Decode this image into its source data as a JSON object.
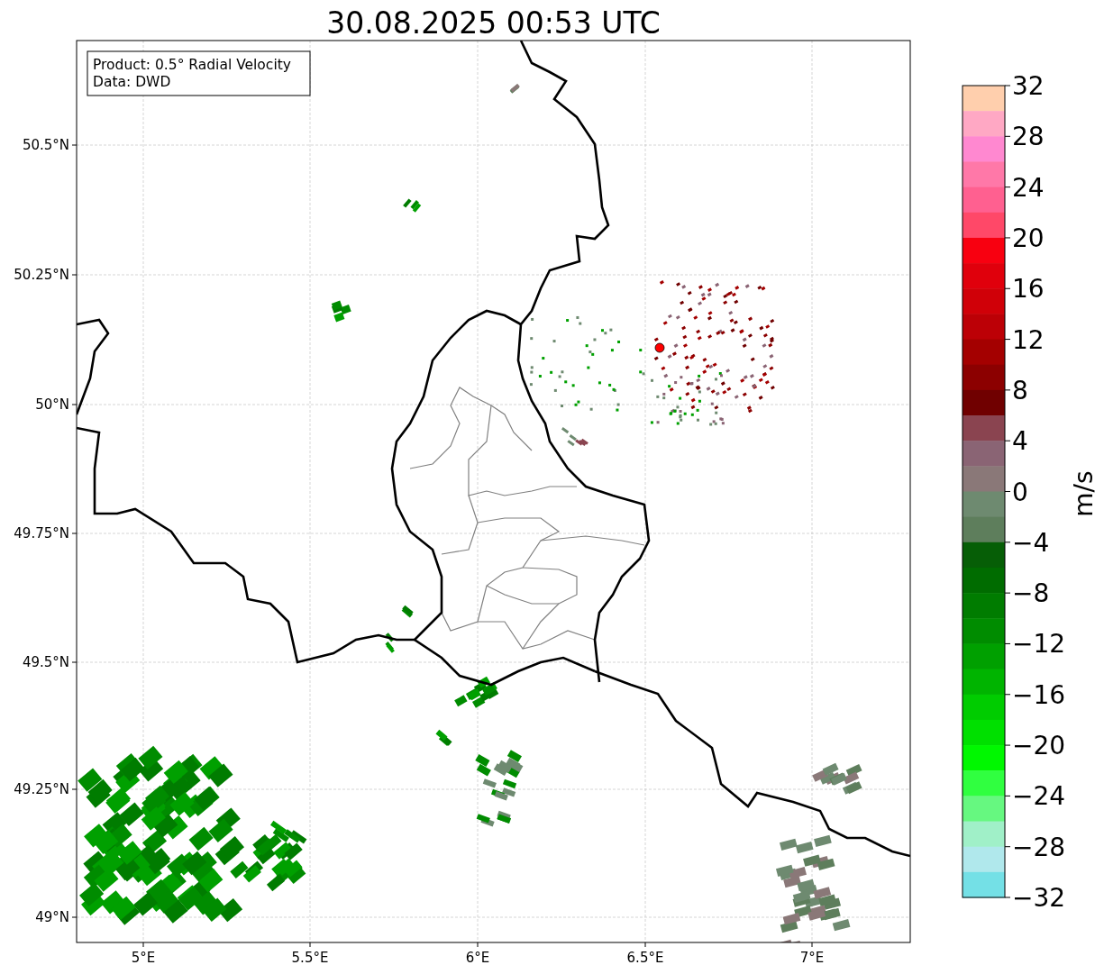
{
  "title": "30.08.2025 00:53 UTC",
  "info_box": [
    "Product: 0.5° Radial Velocity",
    "Data: DWD"
  ],
  "x_ticks": [
    "5°E",
    "5.5°E",
    "6°E",
    "6.5°E",
    "7°E"
  ],
  "y_ticks": [
    "50.5°N",
    "50.25°N",
    "50°N",
    "49.75°N",
    "49.5°N",
    "49.25°N",
    "49°N"
  ],
  "colorbar": {
    "label": "m/s",
    "ticks": [
      "32",
      "28",
      "24",
      "20",
      "16",
      "12",
      "8",
      "4",
      "0",
      "−4",
      "−8",
      "−12",
      "−16",
      "−20",
      "−24",
      "−28",
      "−32"
    ],
    "segments": [
      {
        "color": "#ffcfad"
      },
      {
        "color": "#ffa8c4"
      },
      {
        "color": "#ff88d0"
      },
      {
        "color": "#ff78a8"
      },
      {
        "color": "#ff6090"
      },
      {
        "color": "#ff4868"
      },
      {
        "color": "#f80010"
      },
      {
        "color": "#e0000c"
      },
      {
        "color": "#d00008"
      },
      {
        "color": "#bc0006"
      },
      {
        "color": "#a40000"
      },
      {
        "color": "#8c0000"
      },
      {
        "color": "#700000"
      },
      {
        "color": "#8a4450"
      },
      {
        "color": "#8a6474"
      },
      {
        "color": "#8a7878"
      },
      {
        "color": "#6e8a70"
      },
      {
        "color": "#5e7e5c"
      },
      {
        "color": "#065e06"
      },
      {
        "color": "#006c00"
      },
      {
        "color": "#007c00"
      },
      {
        "color": "#008c00"
      },
      {
        "color": "#00a000"
      },
      {
        "color": "#00b400"
      },
      {
        "color": "#00cc00"
      },
      {
        "color": "#00e000"
      },
      {
        "color": "#00f800"
      },
      {
        "color": "#30ff40"
      },
      {
        "color": "#66f880"
      },
      {
        "color": "#a0f0c8"
      },
      {
        "color": "#b0e8ec"
      },
      {
        "color": "#74e0e6"
      }
    ]
  }
}
